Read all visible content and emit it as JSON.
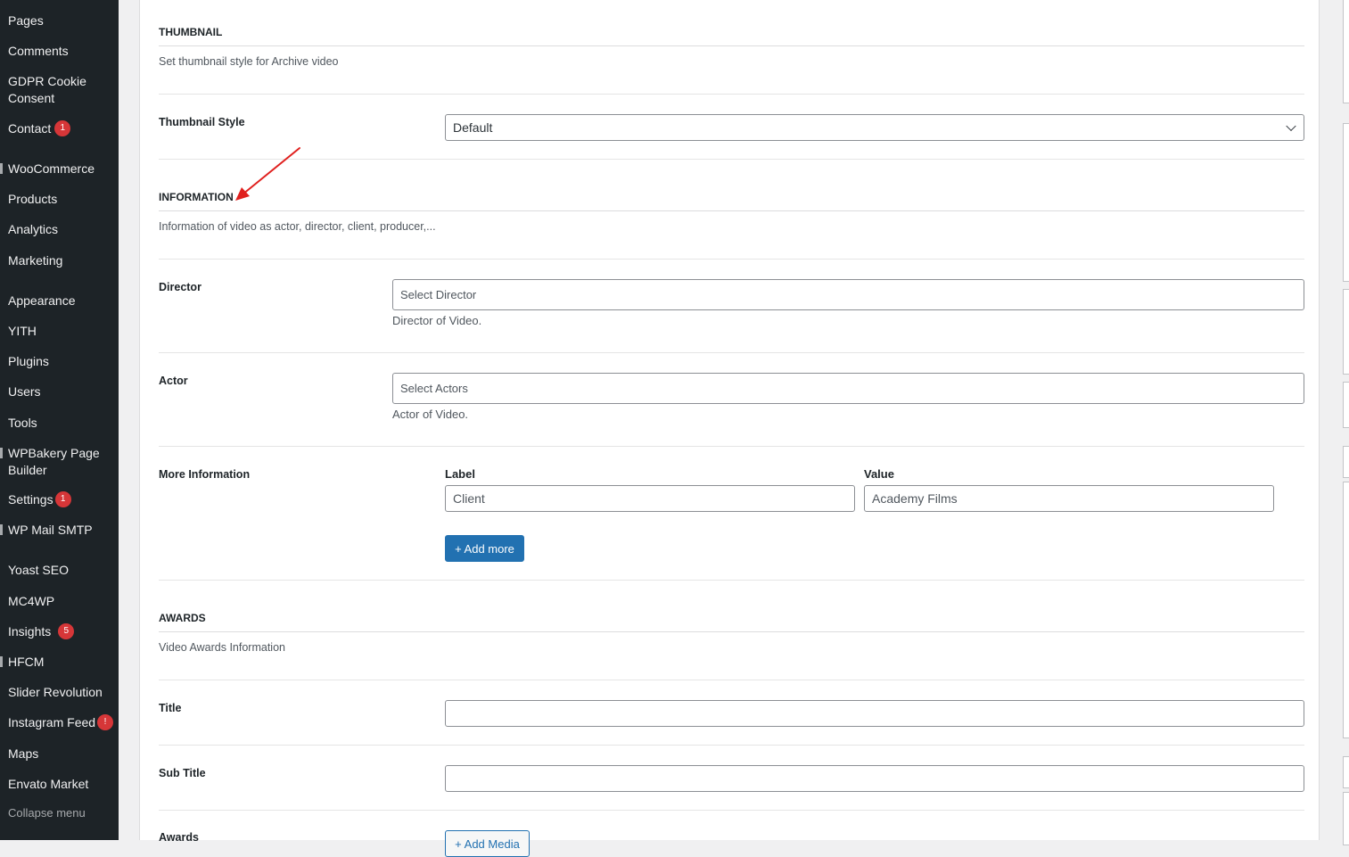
{
  "sidebar": {
    "items": [
      {
        "label": "Pages"
      },
      {
        "label": "Comments"
      },
      {
        "label": "GDPR Cookie Consent"
      },
      {
        "label": "Contact",
        "badge": "1"
      },
      {
        "label": "WooCommerce"
      },
      {
        "label": "Products"
      },
      {
        "label": "Analytics"
      },
      {
        "label": "Marketing"
      },
      {
        "label": "Appearance"
      },
      {
        "label": "YITH"
      },
      {
        "label": "Plugins"
      },
      {
        "label": "Users"
      },
      {
        "label": "Tools"
      },
      {
        "label": "WPBakery Page Builder"
      },
      {
        "label": "Settings",
        "badge": "1"
      },
      {
        "label": "WP Mail SMTP"
      },
      {
        "label": "Yoast SEO"
      },
      {
        "label": "MC4WP"
      },
      {
        "label": "Insights",
        "badge": "5"
      },
      {
        "label": "HFCM"
      },
      {
        "label": "Slider Revolution"
      },
      {
        "label": "Instagram Feed",
        "badge": "!"
      },
      {
        "label": "Maps"
      },
      {
        "label": "Envato Market"
      }
    ],
    "collapse_label": "Collapse menu"
  },
  "thumbnail": {
    "heading": "THUMBNAIL",
    "description": "Set thumbnail style for Archive video",
    "style_label": "Thumbnail Style",
    "style_value": "Default"
  },
  "information": {
    "heading": "INFORMATION",
    "description": "Information of video as actor, director, client, producer,...",
    "director_label": "Director",
    "director_placeholder": "Select Director",
    "director_help": "Director of Video.",
    "actor_label": "Actor",
    "actor_placeholder": "Select Actors",
    "actor_help": "Actor of Video.",
    "more_label": "More Information",
    "col_label": "Label",
    "col_value": "Value",
    "row_label_value": "Client",
    "row_value_value": "Academy Films",
    "add_more": "+ Add more"
  },
  "awards": {
    "heading": "AWARDS",
    "description": "Video Awards Information",
    "title_label": "Title",
    "title_value": "",
    "subtitle_label": "Sub Title",
    "subtitle_value": "",
    "awards_label": "Awards",
    "add_media": "+ Add Media"
  },
  "colors": {
    "sidebar_bg": "#1d2327",
    "accent": "#2271b1",
    "badge": "#d63638",
    "annotation_arrow": "#e0201e"
  }
}
